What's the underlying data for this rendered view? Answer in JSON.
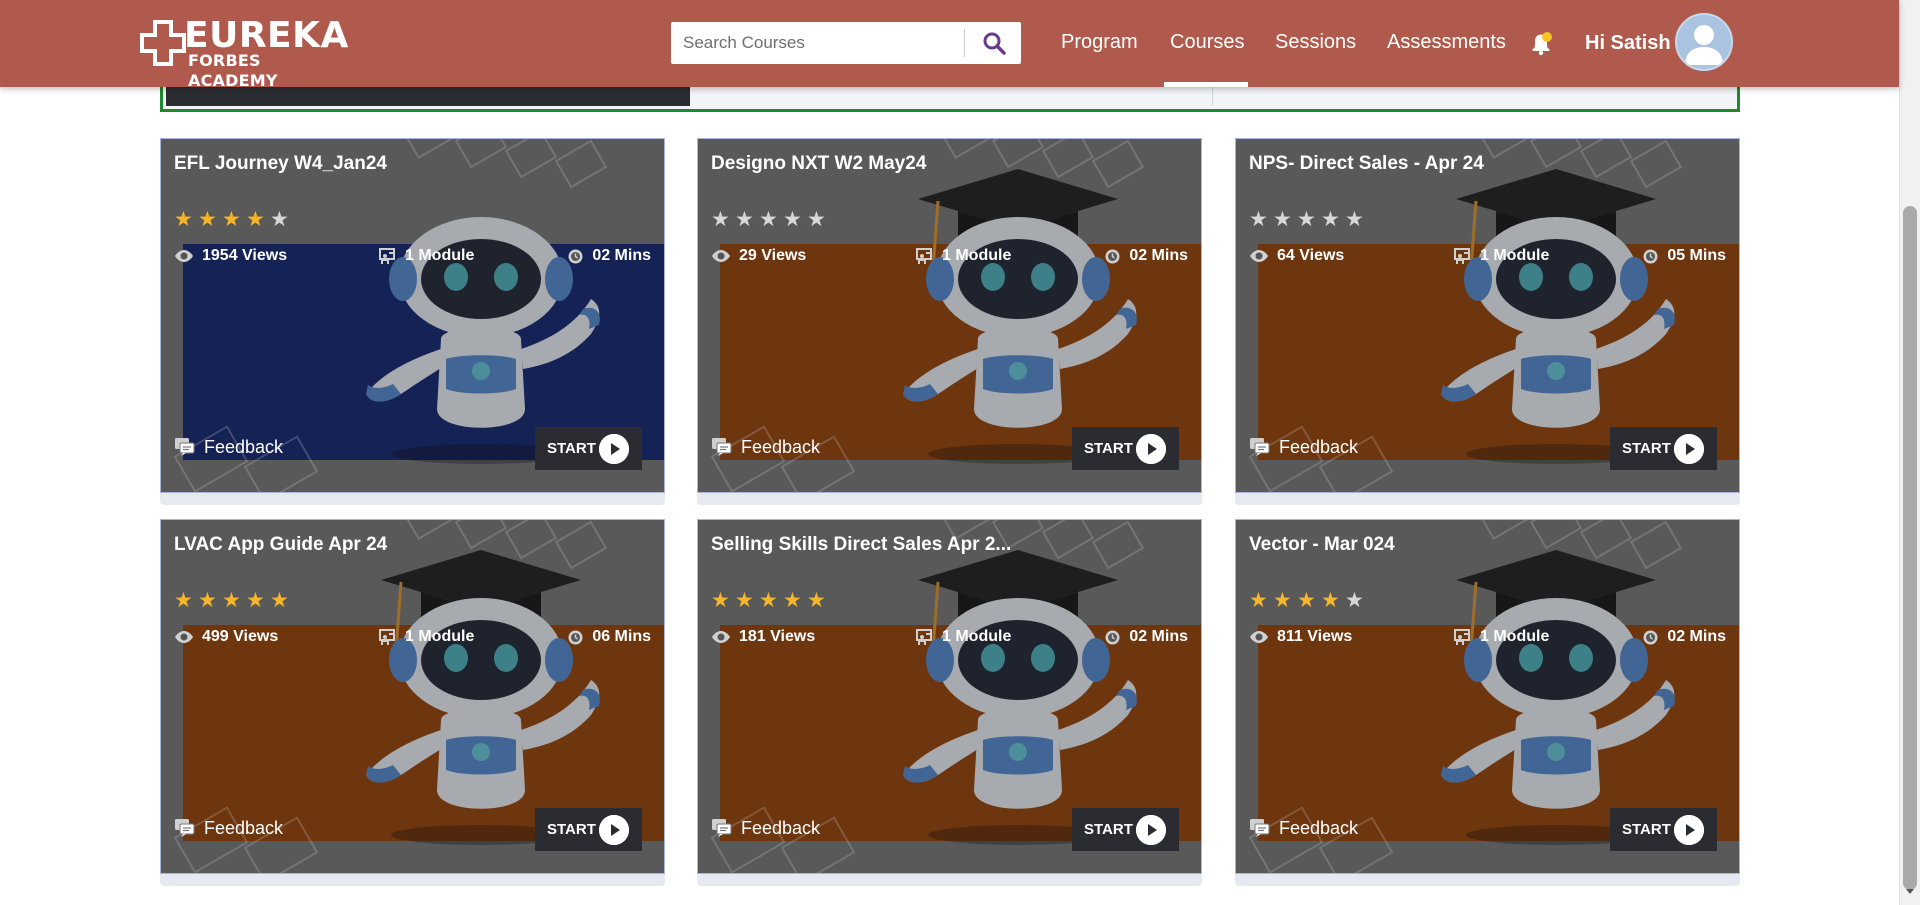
{
  "header": {
    "logo_title": "EUREKA",
    "logo_subtitle": "FORBES ACADEMY",
    "search_placeholder": "Search Courses",
    "nav": [
      {
        "label": "Program"
      },
      {
        "label": "Courses",
        "active": true
      },
      {
        "label": "Sessions"
      },
      {
        "label": "Assessments"
      }
    ],
    "greeting": "Hi Satish"
  },
  "colors": {
    "header_bg": "#b05a4d",
    "star_on": "#f6b52b",
    "star_off": "#d7d7d7",
    "board_orange": "#8a3c06",
    "board_blue": "#0f2168",
    "start_bg": "#2b2c31",
    "panel_border": "#1d8a2d"
  },
  "icons": {
    "search": "search-icon",
    "bell": "bell-icon",
    "avatar": "user-avatar-icon",
    "views": "eye-icon",
    "module": "module-icon",
    "duration": "clock-icon",
    "feedback": "feedback-icon",
    "start": "play-icon"
  },
  "card_labels": {
    "feedback": "Feedback",
    "start": "START"
  },
  "courses": [
    {
      "title": "EFL Journey W4_Jan24",
      "rating": 4,
      "views": "1954 Views",
      "modules": "1 Module",
      "duration": "02 Mins",
      "board": "blue"
    },
    {
      "title": "Designo NXT W2 May24",
      "rating": 0,
      "views": "29 Views",
      "modules": "1 Module",
      "duration": "02 Mins",
      "board": "orange"
    },
    {
      "title": "NPS- Direct Sales - Apr 24",
      "rating": 0,
      "views": "64 Views",
      "modules": "1 Module",
      "duration": "05 Mins",
      "board": "orange"
    },
    {
      "title": "LVAC App Guide Apr 24",
      "rating": 5,
      "views": "499 Views",
      "modules": "1 Module",
      "duration": "06 Mins",
      "board": "orange"
    },
    {
      "title": "Selling Skills Direct Sales Apr 2...",
      "rating": 5,
      "views": "181 Views",
      "modules": "1 Module",
      "duration": "02 Mins",
      "board": "orange"
    },
    {
      "title": "Vector - Mar 024",
      "rating": 4,
      "views": "811 Views",
      "modules": "1 Module",
      "duration": "02 Mins",
      "board": "orange"
    }
  ]
}
